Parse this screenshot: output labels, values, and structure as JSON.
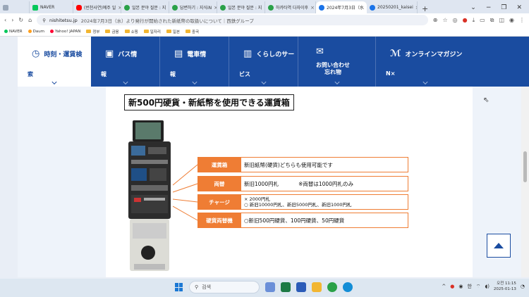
{
  "browser": {
    "tabs": [
      {
        "label": "",
        "color": "#9aa7b8"
      },
      {
        "label": "NAVER",
        "color": "#03c75a"
      },
      {
        "label": "(번천사연)예주 일",
        "color": "#ff0000"
      },
      {
        "label": "일본 분야 질문 : 지",
        "color": "#2aa148"
      },
      {
        "label": "답변하기 : 지식iN",
        "color": "#2aa148"
      },
      {
        "label": "일본 분야 질문 : 지",
        "color": "#2aa148"
      },
      {
        "label": "하카타역 다자이후",
        "color": "#2aa148"
      },
      {
        "label": "2024年7月3日（水",
        "color": "#1a73e8"
      },
      {
        "label": "20250201_kaisei",
        "color": "#1a73e8"
      }
    ],
    "new_tab": "+",
    "address": {
      "domain": "nishitetsu.jp",
      "rest": "2024年7月3日（水）より発行が開始された新紙幣の取扱いについて｜西鉄グループ"
    },
    "bookmarks": [
      {
        "label": "NAVER",
        "kind": "dot",
        "color": "#03c75a"
      },
      {
        "label": "Daum",
        "kind": "dot",
        "color": "#ff9f1c"
      },
      {
        "label": "Yahoo! JAPAN",
        "kind": "dot",
        "color": "#ff0033"
      },
      {
        "label": "정부",
        "kind": "folder"
      },
      {
        "label": "금융",
        "kind": "folder"
      },
      {
        "label": "쇼핑",
        "kind": "folder"
      },
      {
        "label": "일자리",
        "kind": "folder"
      },
      {
        "label": "일본",
        "kind": "folder"
      },
      {
        "label": "중국",
        "kind": "folder"
      }
    ]
  },
  "nav": {
    "items": [
      {
        "icon": "clock",
        "line1": "時刻・運賃検",
        "line2": "索"
      },
      {
        "icon": "bus",
        "line1": "バス情",
        "line2": "報"
      },
      {
        "icon": "train",
        "line1": "電車情",
        "line2": "報"
      },
      {
        "icon": "shop",
        "line1": "くらしのサー",
        "line2": "ビス"
      },
      {
        "icon": "mail",
        "line1": "お問い合わせ",
        "line2": "忘れ物"
      },
      {
        "icon": "magazine",
        "line1": "オンラインマガジン",
        "line2": "N×"
      }
    ]
  },
  "content": {
    "heading": "新500円硬貨・新紙幣を使用できる運賃箱",
    "callouts": [
      {
        "label": "運賃箱",
        "value": "新旧紙幣(硬貨)どちらも使用可能です",
        "note": ""
      },
      {
        "label": "両替",
        "value": "新旧1000円札",
        "note": "※両替は1000円札のみ"
      },
      {
        "label": "チャージ",
        "value": "× 2000円札",
        "value2": "○ 新旧10000円札、新旧5000円札、新旧1000円札"
      },
      {
        "label": "硬貨両替機",
        "value": "○新旧500円硬貨、100円硬貨、50円硬貨",
        "note": ""
      }
    ]
  },
  "taskbar": {
    "search_placeholder": "검색",
    "ime": "한",
    "time": "오전 11:15",
    "date": "2025-01-13"
  },
  "colors": {
    "brand": "#1a4ca0",
    "accent": "#ef7d34"
  }
}
